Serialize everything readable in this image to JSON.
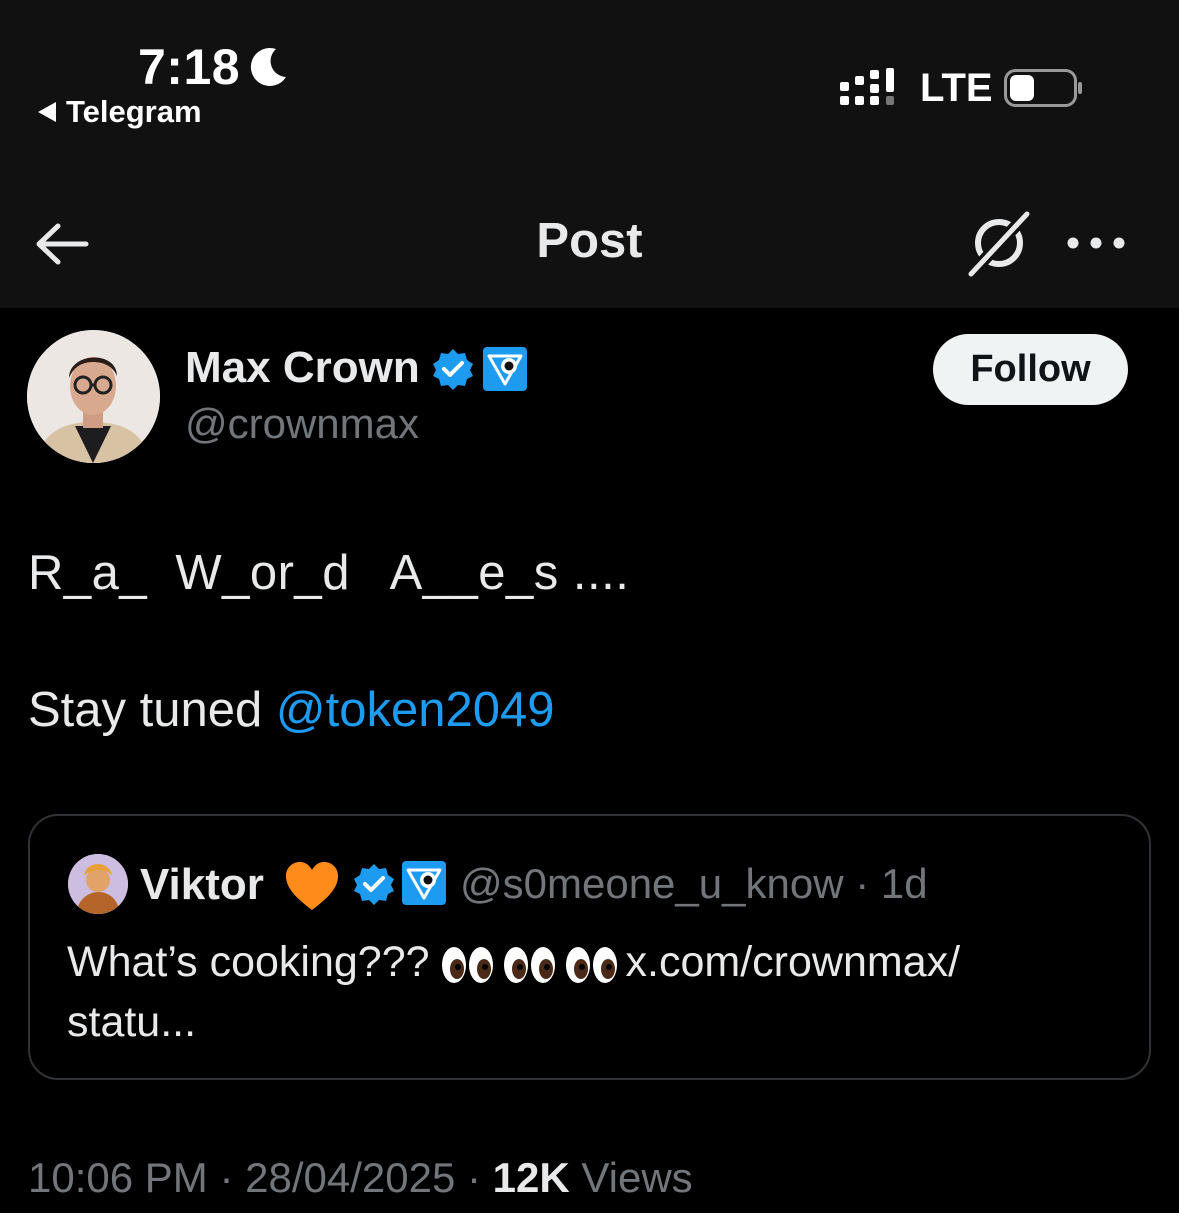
{
  "status_bar": {
    "time": "7:18",
    "back_app": "Telegram",
    "network": "LTE"
  },
  "nav": {
    "title": "Post"
  },
  "author": {
    "name": "Max Crown",
    "handle": "@crownmax",
    "follow_label": "Follow"
  },
  "post": {
    "line1": "R_a_  W_or_d   A__e_s ....",
    "line2_prefix": "Stay tuned ",
    "mention": "@token2049"
  },
  "quote": {
    "name": "Viktor",
    "handle_time": "@s0meone_u_know · 1d",
    "text_prefix": "What’s cooking???",
    "text_link": "x.com/crownmax/",
    "text_suffix": "statu..."
  },
  "meta": {
    "time": "10:06 PM",
    "date": "28/04/2025",
    "views_count": "12K",
    "views_label": "Views",
    "separator": " · "
  },
  "colors": {
    "background": "#000000",
    "header": "#111111",
    "accent": "#1d9bf0",
    "muted": "#71767b",
    "text": "#e7e9ea",
    "border": "#2f3336"
  },
  "icons": [
    "moon-icon",
    "signal-icon",
    "battery-icon",
    "back-arrow-icon",
    "grok-icon",
    "more-icon",
    "verified-icon",
    "affiliate-badge-icon",
    "heart-icon",
    "eyes-emoji"
  ]
}
